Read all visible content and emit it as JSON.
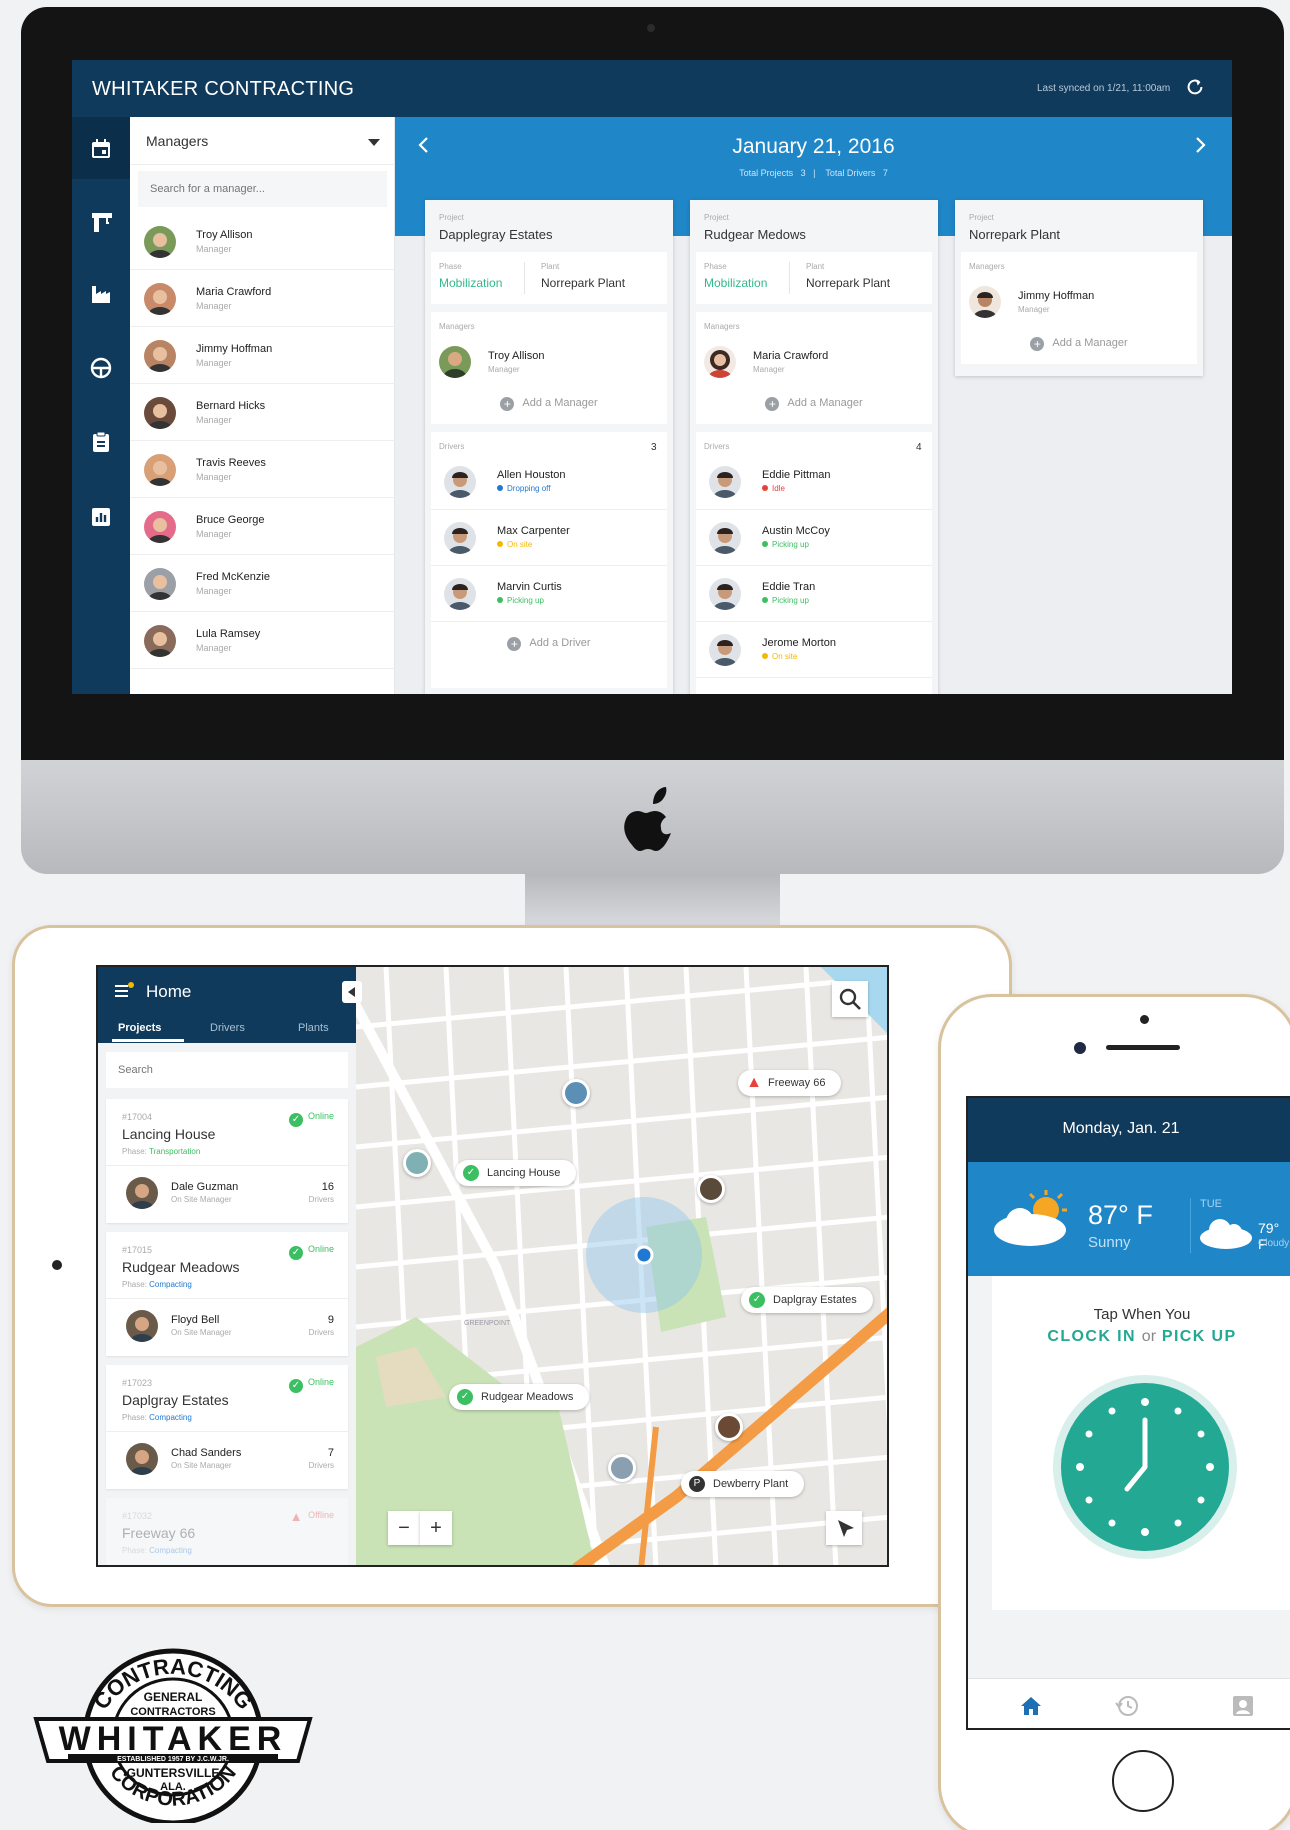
{
  "desktop": {
    "app_title": "WHITAKER CONTRACTING",
    "sync_text": "Last synced on 1/21, 11:00am",
    "managers_panel": {
      "dropdown": "Managers",
      "search_placeholder": "Search for a manager...",
      "managers": [
        {
          "name": "Troy Allison",
          "role": "Manager"
        },
        {
          "name": "Maria Crawford",
          "role": "Manager"
        },
        {
          "name": "Jimmy Hoffman",
          "role": "Manager"
        },
        {
          "name": "Bernard Hicks",
          "role": "Manager"
        },
        {
          "name": "Travis Reeves",
          "role": "Manager"
        },
        {
          "name": "Bruce George",
          "role": "Manager"
        },
        {
          "name": "Fred McKenzie",
          "role": "Manager"
        },
        {
          "name": "Lula Ramsey",
          "role": "Manager"
        }
      ]
    },
    "board": {
      "date": "January 21, 2016",
      "total_projects_label": "Total Projects",
      "total_projects": "3",
      "total_drivers_label": "Total Drivers",
      "total_drivers": "7",
      "projects": [
        {
          "project_label": "Project",
          "name": "Dapplegray Estates",
          "phase_label": "Phase",
          "phase": "Mobilization",
          "plant_label": "Plant",
          "plant": "Norrepark Plant",
          "managers_label": "Managers",
          "manager": {
            "name": "Troy Allison",
            "role": "Manager"
          },
          "add_manager": "Add a Manager",
          "drivers_label": "Drivers",
          "driver_count": "3",
          "drivers": [
            {
              "name": "Allen Houston",
              "status": "Dropping off",
              "color": "#1f78d1"
            },
            {
              "name": "Max Carpenter",
              "status": "On site",
              "color": "#f5b800"
            },
            {
              "name": "Marvin Curtis",
              "status": "Picking up",
              "color": "#3cbf62"
            }
          ],
          "add_driver": "Add a Driver"
        },
        {
          "project_label": "Project",
          "name": "Rudgear Medows",
          "phase_label": "Phase",
          "phase": "Mobilization",
          "plant_label": "Plant",
          "plant": "Norrepark Plant",
          "managers_label": "Managers",
          "manager": {
            "name": "Maria Crawford",
            "role": "Manager"
          },
          "add_manager": "Add a Manager",
          "drivers_label": "Drivers",
          "driver_count": "4",
          "drivers": [
            {
              "name": "Eddie Pittman",
              "status": "Idle",
              "color": "#e8413c"
            },
            {
              "name": "Austin McCoy",
              "status": "Picking up",
              "color": "#3cbf62"
            },
            {
              "name": "Eddie Tran",
              "status": "Picking up",
              "color": "#3cbf62"
            },
            {
              "name": "Jerome Morton",
              "status": "On site",
              "color": "#f5b800"
            }
          ]
        },
        {
          "project_label": "Project",
          "name": "Norrepark Plant",
          "managers_label": "Managers",
          "manager": {
            "name": "Jimmy Hoffman",
            "role": "Manager"
          },
          "add_manager": "Add a Manager"
        }
      ]
    }
  },
  "tablet": {
    "title": "Home",
    "tabs": [
      "Projects",
      "Drivers",
      "Plants"
    ],
    "search_placeholder": "Search",
    "projects": [
      {
        "id": "#17004",
        "name": "Lancing House",
        "phase_label": "Phase:",
        "phase": "Transportation",
        "phase_color": "#3cbf62",
        "status": "Online",
        "manager": "Dale Guzman",
        "manager_role": "On Site Manager",
        "drivers": "16",
        "drivers_label": "Drivers"
      },
      {
        "id": "#17015",
        "name": "Rudgear Meadows",
        "phase_label": "Phase:",
        "phase": "Compacting",
        "phase_color": "#1f78d1",
        "status": "Online",
        "manager": "Floyd Bell",
        "manager_role": "On Site Manager",
        "drivers": "9",
        "drivers_label": "Drivers"
      },
      {
        "id": "#17023",
        "name": "Daplgray Estates",
        "phase_label": "Phase:",
        "phase": "Compacting",
        "phase_color": "#1f78d1",
        "status": "Online",
        "manager": "Chad Sanders",
        "manager_role": "On Site Manager",
        "drivers": "7",
        "drivers_label": "Drivers"
      },
      {
        "id": "#17032",
        "name": "Freeway 66",
        "phase_label": "Phase:",
        "phase": "Compacting",
        "status": "Offline"
      }
    ],
    "map": {
      "labels": {
        "freeway": "Freeway 66",
        "lancing": "Lancing House",
        "daplgray": "Daplgray Estates",
        "rudgear": "Rudgear Meadows",
        "dewberry": "Dewberry Plant",
        "greenpoint": "GREENPOINT"
      },
      "zoom_out": "−",
      "zoom_in": "+"
    }
  },
  "phone": {
    "date": "Monday, Jan. 21",
    "temp": "87° F",
    "condition": "Sunny",
    "next_day": "TUE",
    "next_temp": "79° F",
    "next_condition": "Cloudy",
    "prompt_line1": "Tap When You",
    "clock_in": "CLOCK IN",
    "or": "or",
    "pick_up": "PICK UP"
  },
  "logo": {
    "top": "CONTRACTING",
    "sub1": "GENERAL",
    "sub2": "CONTRACTORS",
    "name": "WHITAKER",
    "est": "ESTABLISHED 1957 BY J.C.W.JR.",
    "city": "GUNTERSVILLE",
    "state": "ALA.",
    "bottom": "CORPORATION"
  }
}
